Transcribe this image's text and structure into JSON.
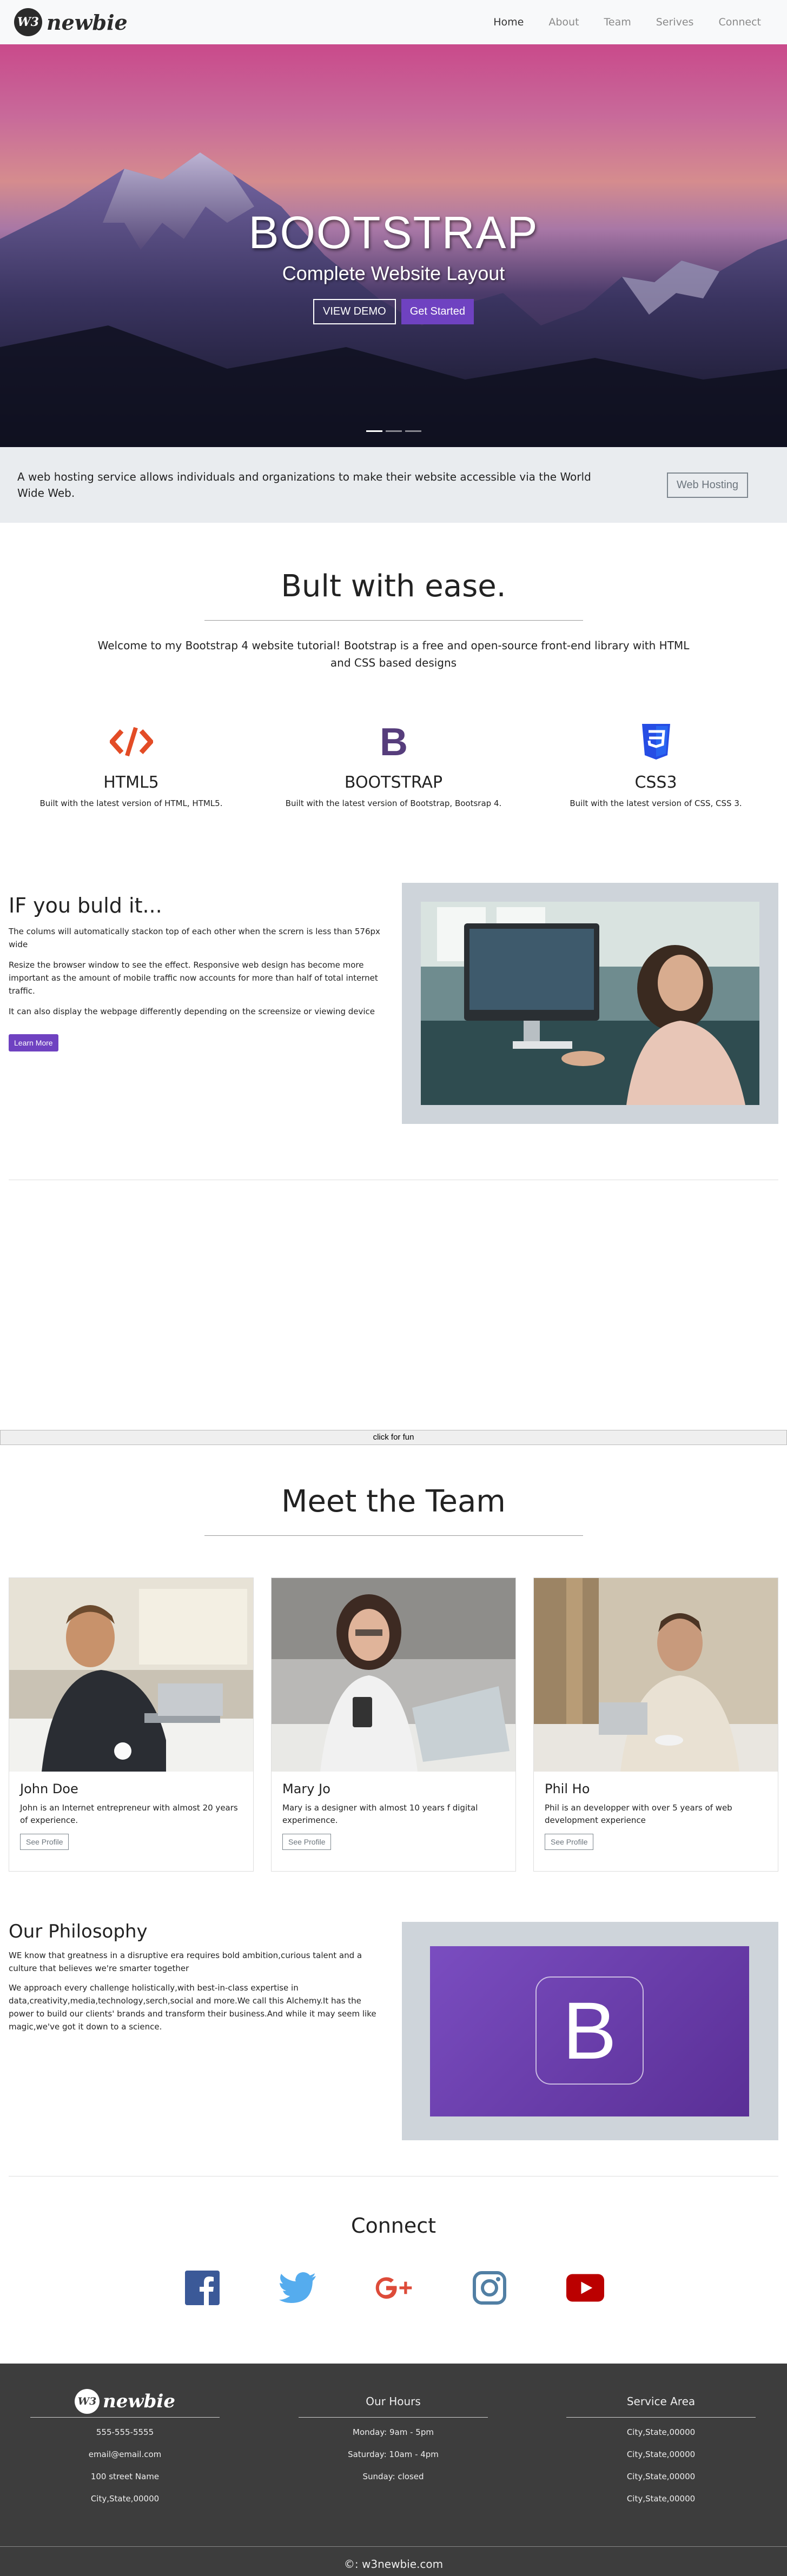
{
  "nav": {
    "logo_badge": "W3",
    "logo_text": "newbie",
    "links": [
      "Home",
      "About",
      "Team",
      "Serives",
      "Connect"
    ]
  },
  "hero": {
    "title": "BOOTSTRAP",
    "subtitle": "Complete Website Layout",
    "btn_demo": "VIEW DEMO",
    "btn_start": "Get Started",
    "slides": 3,
    "active_slide": 1
  },
  "jumbotron": {
    "text": "A web hosting service allows individuals and organizations to make their website accessible via the World Wide Web.",
    "button": "Web Hosting"
  },
  "built": {
    "title": "Bult with ease.",
    "lead": "Welcome to my Bootstrap 4 website tutorial! Bootstrap is a free and open-source front-end library with HTML and CSS based designs",
    "features": [
      {
        "icon": "html5-code-icon",
        "title": "HTML5",
        "text": "Built with the latest version of HTML, HTML5."
      },
      {
        "icon": "bootstrap-icon",
        "title": "BOOTSTRAP",
        "text": "Built with the latest version of Bootstrap, Bootsrap 4."
      },
      {
        "icon": "css3-icon",
        "title": "CSS3",
        "text": "Built with the latest version of CSS, CSS 3."
      }
    ]
  },
  "ifbuild": {
    "title": "IF you buld it...",
    "p1": "The colums will automatically stackon top of each other when the scrern is less than 576px wide",
    "p2": "Resize the browser window to see the effect. Responsive web design has become more important as the amount of mobile traffic now accounts for more than half of total internet traffic.",
    "p3": "It can also display the webpage differently depending on the screensize or viewing device",
    "button": "Learn More"
  },
  "fun": {
    "label": "click for fun"
  },
  "team": {
    "title": "Meet the Team",
    "members": [
      {
        "name": "John Doe",
        "bio": "John is an Internet entrepreneur with almost 20 years of experience.",
        "button": "See Profile"
      },
      {
        "name": "Mary Jo",
        "bio": "Mary is a designer with almost 10 years f digital experimence.",
        "button": "See Profile"
      },
      {
        "name": "Phil Ho",
        "bio": "Phil is an developper with over 5 years of web development experience",
        "button": "See Profile"
      }
    ]
  },
  "philosophy": {
    "title": "Our Philosophy",
    "p1": "WE know that greatness in a disruptive era requires bold ambition,curious talent and a culture that believes we're smarter together",
    "p2": "We approach every challenge holistically,with best-in-class expertise in data,creativity,media,technology,serch,social and more.We call this Alchemy.It has the power to build our clients' brands and transform their business.And while it may seem like magic,we've got it down to a science.",
    "logo_letter": "B"
  },
  "connect": {
    "title": "Connect",
    "icons": [
      "facebook-icon",
      "twitter-icon",
      "google-plus-icon",
      "instagram-icon",
      "youtube-icon"
    ],
    "colors": {
      "facebook": "#3b5998",
      "twitter": "#55acee",
      "google": "#dd4b39",
      "instagram": "#517fa4",
      "youtube": "#bb0000"
    }
  },
  "footer": {
    "contact": [
      "555-555-5555",
      "email@email.com",
      "100 street Name",
      "City,State,00000"
    ],
    "hours_title": "Our Hours",
    "hours": [
      "Monday: 9am - 5pm",
      "Saturday: 10am - 4pm",
      "Sunday: closed"
    ],
    "area_title": "Service Area",
    "areas": [
      "City,State,00000",
      "City,State,00000",
      "City,State,00000",
      "City,State,00000"
    ],
    "copyright": "©: w3newbie.com"
  },
  "colors": {
    "accent": "#6f42c1",
    "footer_bg": "#3d3d3d",
    "jumbotron_bg": "#e9ecef"
  }
}
